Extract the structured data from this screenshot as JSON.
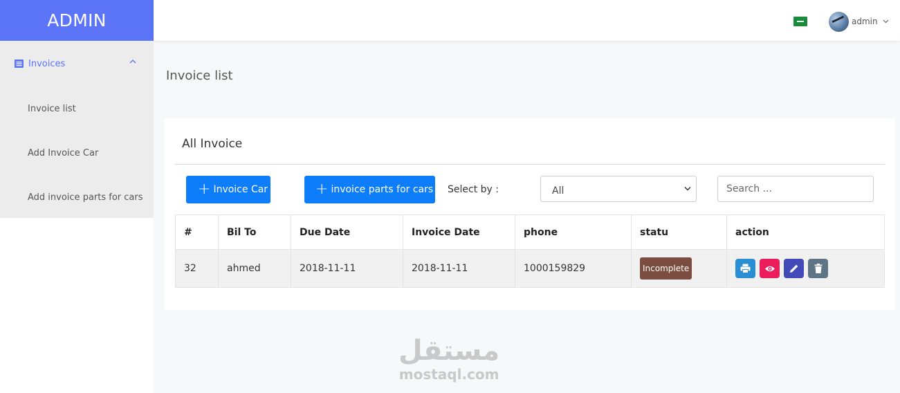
{
  "brand": {
    "title": "ADMIN",
    "color": "#5b74f8"
  },
  "sidebar": {
    "parent": {
      "label": "Invoices",
      "icon": "document-list-icon",
      "expanded": true
    },
    "items": [
      {
        "label": "Invoice list"
      },
      {
        "label": "Add Invoice Car"
      },
      {
        "label": "Add invoice parts for cars"
      }
    ]
  },
  "topbar": {
    "flag_icon": "saudi-flag-icon",
    "user": {
      "name": "admin",
      "icon": "avatar"
    }
  },
  "page": {
    "title": "Invoice list"
  },
  "card": {
    "title": "All Invoice",
    "buttons": {
      "invoice_car": "Invoice Car",
      "invoice_parts": "invoice parts for cars"
    },
    "select_label": "Select by :",
    "select_value": "All",
    "search_placeholder": "Search ..."
  },
  "table": {
    "headers": [
      "#",
      "Bil To",
      "Due Date",
      "Invoice Date",
      "phone",
      "statu",
      "action"
    ],
    "rows": [
      {
        "id": "32",
        "bill_to": "ahmed",
        "due_date": "2018-11-11",
        "invoice_date": "2018-11-11",
        "phone": "1000159829",
        "status": "Incomplete"
      }
    ],
    "status_color": "#7a4d40",
    "action_icons": [
      "print-icon",
      "eye-icon",
      "pencil-icon",
      "trash-icon"
    ]
  },
  "watermark": {
    "arabic": "مستقل",
    "latin": "mostaql.com"
  },
  "colors": {
    "primary_button": "#0d7df9",
    "print": "#2a8ed2",
    "view": "#ec1d5c",
    "edit": "#4349b6",
    "delete": "#5d7584"
  }
}
